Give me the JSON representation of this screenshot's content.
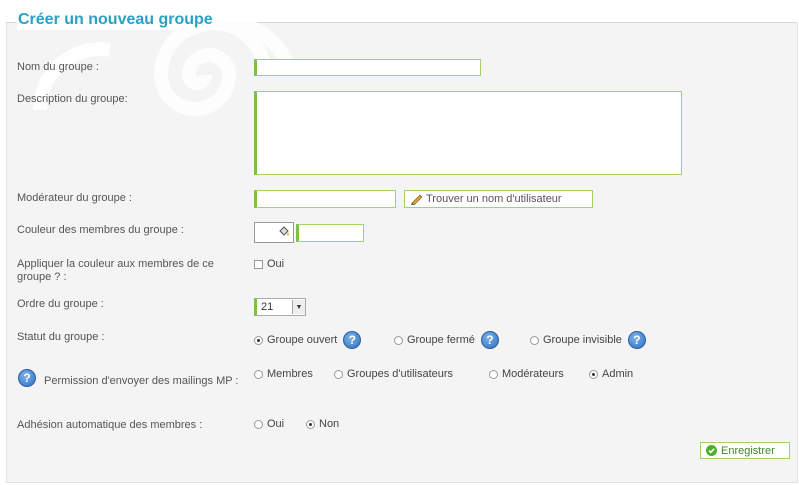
{
  "form": {
    "title": "Créer un nouveau groupe",
    "name_label": "Nom du groupe :",
    "name_value": "",
    "description_label": "Description du groupe:",
    "description_value": "",
    "moderator_label": "Modérateur du groupe :",
    "moderator_value": "",
    "find_user_button": "Trouver un nom d'utilisateur",
    "color_label": "Couleur des membres du groupe :",
    "color_value": "",
    "apply_color_label": "Appliquer la couleur aux membres de ce groupe ? :",
    "apply_color_option": "Oui",
    "order_label": "Ordre du groupe :",
    "order_value": "21",
    "status_label": "Statut du groupe :",
    "status_options": [
      "Groupe ouvert",
      "Groupe fermé",
      "Groupe invisible"
    ],
    "status_selected": "Groupe ouvert",
    "mailing_label": "Permission d'envoyer des mailings MP :",
    "mailing_options": [
      "Membres",
      "Groupes d'utilisateurs",
      "Modérateurs",
      "Admin"
    ],
    "mailing_selected": "Admin",
    "auto_join_label": "Adhésion automatique des membres :",
    "auto_join_options": [
      "Oui",
      "Non"
    ],
    "auto_join_selected": "Non",
    "save_button": "Enregistrer"
  },
  "icons": {
    "help": "question-mark-icon",
    "pencil": "pencil-icon",
    "palette": "paint-bucket-icon",
    "save": "check-circle-icon",
    "dropdown": "chevron-down-icon"
  },
  "colors": {
    "accent": "#2aa0c6",
    "field_border": "#7cc241"
  }
}
